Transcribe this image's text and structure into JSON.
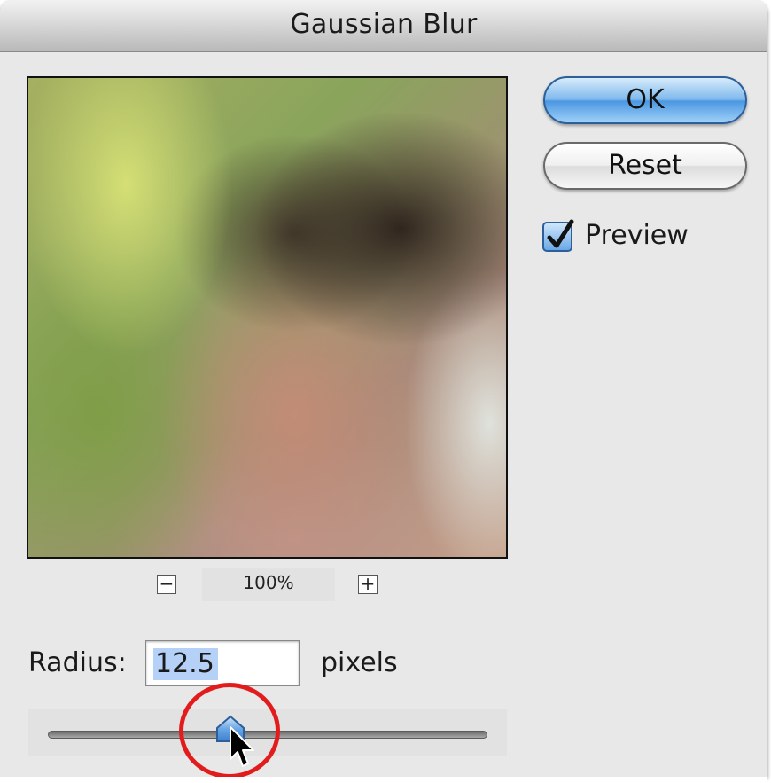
{
  "dialog": {
    "title": "Gaussian Blur"
  },
  "buttons": {
    "ok_label": "OK",
    "reset_label": "Reset"
  },
  "preview_option": {
    "label": "Preview",
    "checked": true
  },
  "zoom": {
    "minus_symbol": "−",
    "plus_symbol": "+",
    "value": "100%"
  },
  "radius": {
    "label": "Radius:",
    "value": "12.5",
    "unit": "pixels",
    "slider_fraction": 0.4
  },
  "colors": {
    "ok_button": "#5aa2e6",
    "highlight_circle": "#e21c1c",
    "selection": "#b5d1f7"
  }
}
